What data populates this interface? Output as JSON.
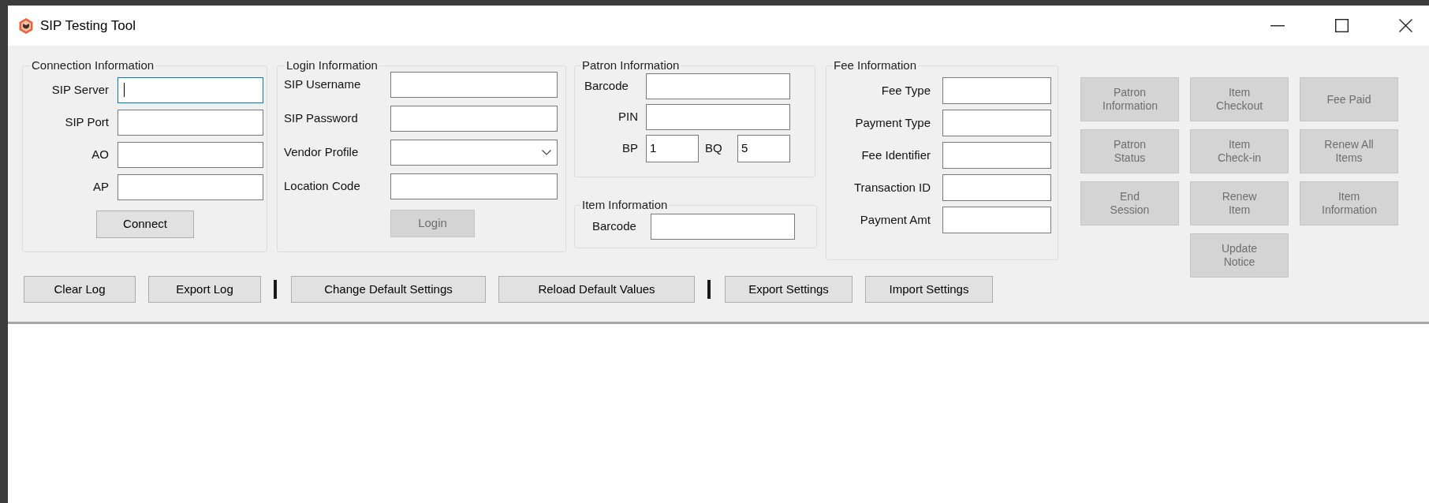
{
  "window": {
    "title": "SIP Testing Tool"
  },
  "connection": {
    "title": "Connection Information",
    "fields": [
      {
        "label": "SIP Server",
        "focused": true
      },
      {
        "label": "SIP Port",
        "focused": false
      },
      {
        "label": "AO",
        "focused": false
      },
      {
        "label": "AP",
        "focused": false
      }
    ],
    "button": {
      "label": "Connect",
      "disabled": false
    }
  },
  "login": {
    "title": "Login Information",
    "fields": [
      {
        "label": "SIP Username",
        "kind": "text"
      },
      {
        "label": "SIP Password",
        "kind": "text"
      },
      {
        "label": "Vendor Profile",
        "kind": "dropdown"
      },
      {
        "label": "Location Code",
        "kind": "text"
      }
    ],
    "button": {
      "label": "Login",
      "disabled": true
    }
  },
  "patron": {
    "title": "Patron Information",
    "barcode": {
      "label": "Barcode"
    },
    "pin": {
      "label": "PIN"
    },
    "bp": {
      "label": "BP",
      "value": "1"
    },
    "bq": {
      "label": "BQ",
      "value": "5"
    }
  },
  "item": {
    "title": "Item Information",
    "barcode": {
      "label": "Barcode"
    }
  },
  "fee": {
    "title": "Fee Information",
    "fields": [
      {
        "label": "Fee Type"
      },
      {
        "label": "Payment Type"
      },
      {
        "label": "Fee Identifier"
      },
      {
        "label": "Transaction ID"
      },
      {
        "label": "Payment Amt"
      }
    ]
  },
  "actions": [
    {
      "label": "Patron Information",
      "disabled": true
    },
    {
      "label": "Item Checkout",
      "disabled": true
    },
    {
      "label": "Fee Paid",
      "disabled": true
    },
    {
      "label": "Patron Status",
      "disabled": true
    },
    {
      "label": "Item Check-in",
      "disabled": true
    },
    {
      "label": "Renew All Items",
      "disabled": true
    },
    {
      "label": "End Session",
      "disabled": true
    },
    {
      "label": "Renew Item",
      "disabled": true
    },
    {
      "label": "Item Information",
      "disabled": true
    },
    {
      "label": "Update Notice",
      "disabled": true
    }
  ],
  "toolbar": [
    {
      "kind": "button",
      "label": "Clear Log"
    },
    {
      "kind": "button",
      "label": "Export Log"
    },
    {
      "kind": "separator"
    },
    {
      "kind": "button",
      "label": "Change Default Settings"
    },
    {
      "kind": "button",
      "label": "Reload Default Values"
    },
    {
      "kind": "separator"
    },
    {
      "kind": "button",
      "label": "Export Settings"
    },
    {
      "kind": "button",
      "label": "Import Settings"
    }
  ]
}
